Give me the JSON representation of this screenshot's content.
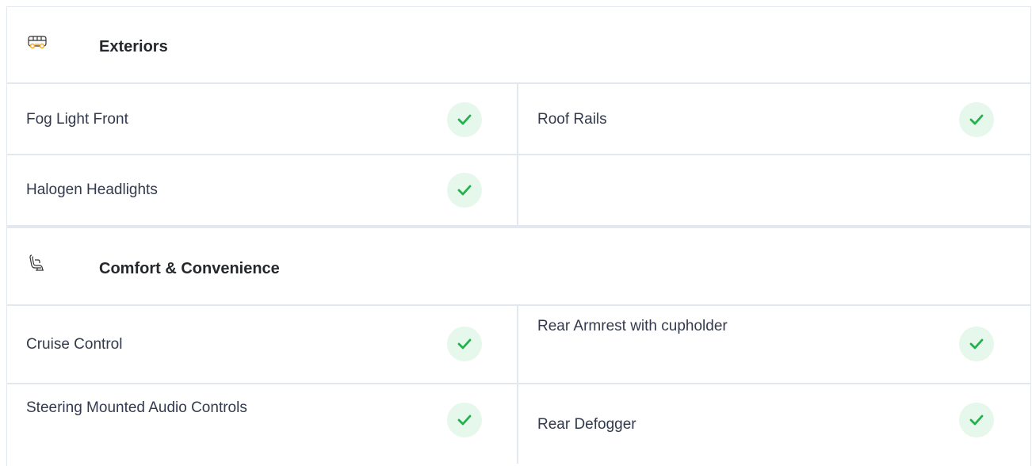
{
  "sections": [
    {
      "title": "Exteriors",
      "icon": "car-exterior-icon",
      "rows": [
        {
          "left": "Fog Light Front",
          "left_checked": true,
          "right": "Roof Rails",
          "right_checked": true
        },
        {
          "left": "Halogen Headlights",
          "left_checked": true,
          "right": "",
          "right_checked": false
        }
      ]
    },
    {
      "title": "Comfort & Convenience",
      "icon": "car-seat-icon",
      "rows": [
        {
          "left": "Cruise Control",
          "left_checked": true,
          "right": "Rear Armrest with cupholder",
          "right_checked": true
        },
        {
          "left": "Steering Mounted Audio Controls",
          "left_checked": true,
          "right": "Rear Defogger",
          "right_checked": true
        }
      ]
    }
  ],
  "colors": {
    "check_bg": "#e6f7ec",
    "check_mark": "#22b14c",
    "border": "#e3e8ee",
    "icon_accent": "#f5a623"
  }
}
